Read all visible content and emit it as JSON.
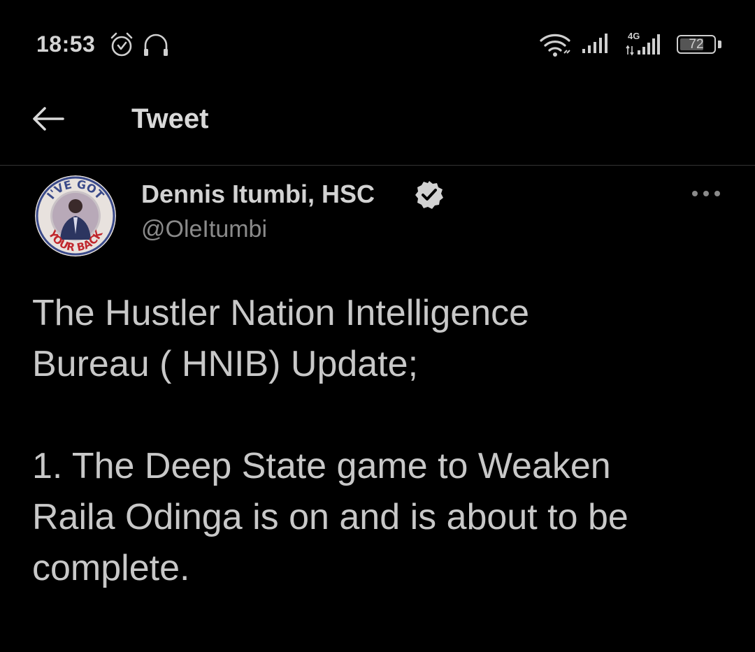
{
  "status_bar": {
    "time": "18:53",
    "network": "4G",
    "battery": "72",
    "battery_level_percent": 72,
    "icons": [
      "alarm-icon",
      "headset-icon",
      "wifi-icon",
      "signal-icon",
      "signal-icon"
    ]
  },
  "header": {
    "title": "Tweet",
    "back_icon": "arrow-left-icon"
  },
  "tweet": {
    "author_name": "Dennis Itumbi, HSC",
    "author_handle": "@OleItumbi",
    "verified": true,
    "avatar_text_top": "I'VE GOT",
    "avatar_text_bottom": "YOUR BACK",
    "more_icon": "more-horizontal-icon",
    "text_lines": [
      "The Hustler Nation Intelligence",
      "Bureau ( HNIB) Update;",
      "",
      "1. The Deep State game to Weaken",
      "Raila Odinga is on and is about to be",
      "complete."
    ]
  },
  "colors": {
    "background": "#000000",
    "text_primary": "#d2d2d2",
    "text_secondary": "#8a8a8a",
    "divider": "#333333"
  }
}
